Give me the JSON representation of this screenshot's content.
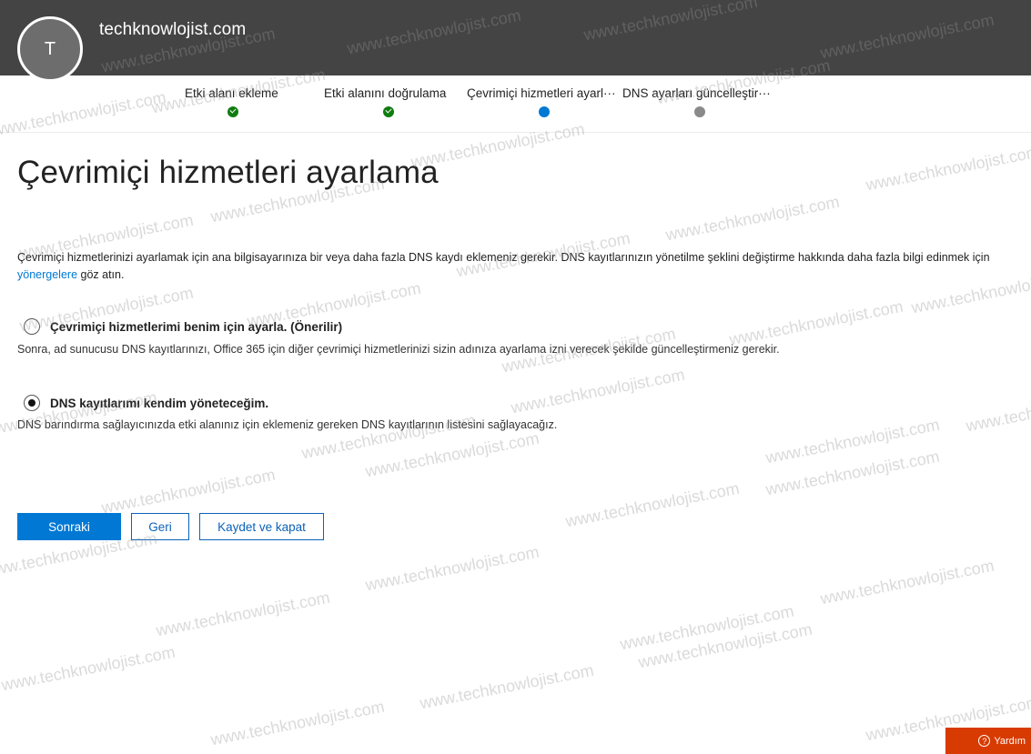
{
  "header": {
    "avatar_initial": "T",
    "domain": "techknowlojist.com"
  },
  "steps": [
    {
      "label": "Etki alanı ekleme",
      "state": "done"
    },
    {
      "label": "Etki alanını doğrulama",
      "state": "done"
    },
    {
      "label": "Çevrimiçi hizmetleri ayarl···",
      "state": "current"
    },
    {
      "label": "DNS ayarları güncelleştir···",
      "state": "pending"
    }
  ],
  "page": {
    "title": "Çevrimiçi hizmetleri ayarlama",
    "intro_line1": "Çevrimiçi hizmetlerinizi ayarlamak için ana bilgisayarınıza bir veya daha fazla DNS kaydı eklemeniz gerekir. DNS kayıtlarınızın yönetilme şeklini değiştirme hakkında daha fazla bilgi edinmek için",
    "intro_link": "yönergelere",
    "intro_line2_rest": " göz atın."
  },
  "options": [
    {
      "label": "Çevrimiçi hizmetlerimi benim için ayarla. (Önerilir)",
      "description": "Sonra, ad sunucusu DNS kayıtlarınızı, Office 365 için diğer çevrimiçi hizmetlerinizi sizin adınıza ayarlama izni verecek şekilde güncelleştirmeniz gerekir.",
      "selected": false
    },
    {
      "label": "DNS kayıtlarımı kendim yöneteceğim.",
      "description": "DNS barındırma sağlayıcınızda etki alanınız için eklemeniz gereken DNS kayıtlarının listesini sağlayacağız.",
      "selected": true
    }
  ],
  "buttons": {
    "next": "Sonraki",
    "back": "Geri",
    "save_close": "Kaydet ve kapat"
  },
  "help": {
    "label": "Yardım",
    "icon": "question-circle-icon"
  },
  "watermark": "www.techknowlojist.com",
  "colors": {
    "header_bg": "#444444",
    "accent": "#0078d4",
    "done": "#107c10",
    "pending": "#8a8a8a",
    "help_bg": "#d83b01"
  }
}
